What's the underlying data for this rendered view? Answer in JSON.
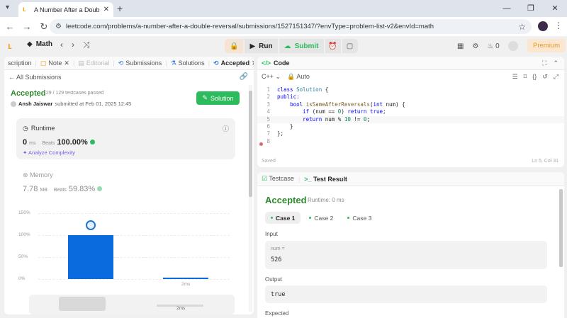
{
  "browser": {
    "tab_title": "A Number After a Double Reve",
    "url": "leetcode.com/problems/a-number-after-a-double-reversal/submissions/1527151347/?envType=problem-list-v2&envId=math"
  },
  "nav": {
    "problem_list": "Math",
    "run_label": "Run",
    "submit_label": "Submit",
    "streak": "0",
    "premium_label": "Premium"
  },
  "left_tabs": [
    {
      "label": "scription"
    },
    {
      "label": "Note"
    },
    {
      "label": "Editorial"
    },
    {
      "label": "Submissions"
    },
    {
      "label": "Solutions"
    },
    {
      "label": "Accepted"
    }
  ],
  "submission": {
    "back_label": "All Submissions",
    "status": "Accepted",
    "testcases": "129 / 129 testcases passed",
    "author": "Ansh Jaiswar",
    "submitted": "submitted at Feb 01, 2025 12:45",
    "solution_btn": "Solution",
    "runtime": {
      "title": "Runtime",
      "value": "0",
      "unit": "ms",
      "beats_label": "Beats",
      "beats": "100.00%",
      "analyze": "Analyze Complexity"
    },
    "memory": {
      "title": "Memory",
      "value": "7.78",
      "unit": "MB",
      "beats_label": "Beats",
      "beats": "59.83%"
    }
  },
  "chart_data": {
    "type": "bar",
    "y_ticks": [
      "150%",
      "100%",
      "50%",
      "0%"
    ],
    "ylim": [
      0,
      150
    ],
    "bars": [
      {
        "label": "",
        "value": 100
      },
      {
        "label": "2ms",
        "value": 4
      }
    ],
    "mini_label": "2ms"
  },
  "editor": {
    "title": "Code",
    "language": "C++",
    "auto_label": "Auto",
    "lines": [
      {
        "n": "1"
      },
      {
        "n": "2"
      },
      {
        "n": "3"
      },
      {
        "n": "4"
      },
      {
        "n": "5"
      },
      {
        "n": "6"
      },
      {
        "n": "7"
      },
      {
        "n": "8"
      }
    ],
    "code_text": {
      "class_kw": "class",
      "class_name": "Solution",
      "public_kw": "public:",
      "bool_kw": "bool",
      "fn_name": "isSameAfterReversals",
      "int_kw": "int",
      "param": "num",
      "if_kw": "if",
      "cond_var": "num",
      "op_eq": "==",
      "zero": "0",
      "return_kw": "return",
      "true_kw": "true",
      "ret2": "return",
      "expr_var": "num",
      "mod": "%",
      "ten": "10",
      "neq": "!=",
      "zero2": "0"
    },
    "saved": "Saved",
    "position": "Ln 5, Col 31"
  },
  "results": {
    "testcase_tab": "Testcase",
    "result_tab": "Test Result",
    "status": "Accepted",
    "runtime": "Runtime: 0 ms",
    "cases": [
      "Case 1",
      "Case 2",
      "Case 3"
    ],
    "input_label": "Input",
    "input_key": "num =",
    "input_value": "526",
    "output_label": "Output",
    "output_value": "true",
    "expected_label": "Expected"
  },
  "colors": {
    "accepted": "#2d8a2d",
    "submit": "#2cbb5d",
    "bar": "#0a6bde"
  }
}
